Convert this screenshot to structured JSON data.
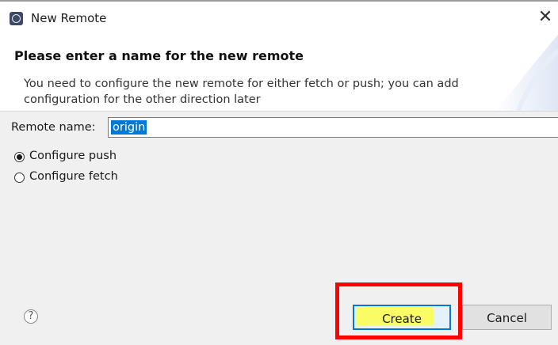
{
  "window": {
    "title": "New Remote",
    "close_glyph": "✕"
  },
  "header": {
    "title": "Please enter a name for the new remote",
    "message": "You need to configure the new remote for either fetch or push; you can add configuration for the other direction later"
  },
  "form": {
    "remote_name_label": "Remote name:",
    "remote_name_value": "origin",
    "options": [
      {
        "label": "Configure push",
        "checked": true
      },
      {
        "label": "Configure fetch",
        "checked": false
      }
    ]
  },
  "footer": {
    "help_glyph": "?",
    "create_label": "Create",
    "cancel_label": "Cancel"
  },
  "icons": [
    "app-icon",
    "close-icon",
    "help-icon"
  ],
  "colors": {
    "selection": "#0078d7",
    "annotation_box": "#ff0000",
    "highlighter": "#ffff33"
  }
}
